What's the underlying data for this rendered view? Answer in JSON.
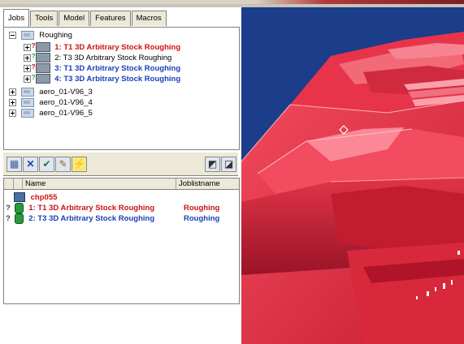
{
  "tabs": [
    "Jobs",
    "Tools",
    "Model",
    "Features",
    "Macros"
  ],
  "tree": {
    "root": "Roughing",
    "jobs": [
      {
        "label": "1: T1 3D Arbitrary Stock Roughing",
        "style": "red"
      },
      {
        "label": "2: T3 3D Arbitrary Stock Roughing",
        "style": "plain"
      },
      {
        "label": "3: T1 3D Arbitrary Stock Roughing",
        "style": "blue"
      },
      {
        "label": "4: T3 3D Arbitrary Stock Roughing",
        "style": "blue"
      }
    ],
    "groups": [
      "aero_01-V96_3",
      "aero_01-V96_4",
      "aero_01-V96_5"
    ]
  },
  "list": {
    "col_name": "Name",
    "col_joblist": "Joblistname",
    "machine": "chp055",
    "rows": [
      {
        "name": "1: T1 3D Arbitrary Stock Roughing",
        "joblist": "Roughing",
        "style": "red"
      },
      {
        "name": "2: T3 3D Arbitrary Stock Roughing",
        "joblist": "Roughing",
        "style": "blue"
      }
    ]
  },
  "colors": {
    "viewport_bg": "#1b3d8a",
    "model_red": "#e8344a",
    "job_red": "#cc1111",
    "job_blue": "#1a3fb8"
  }
}
